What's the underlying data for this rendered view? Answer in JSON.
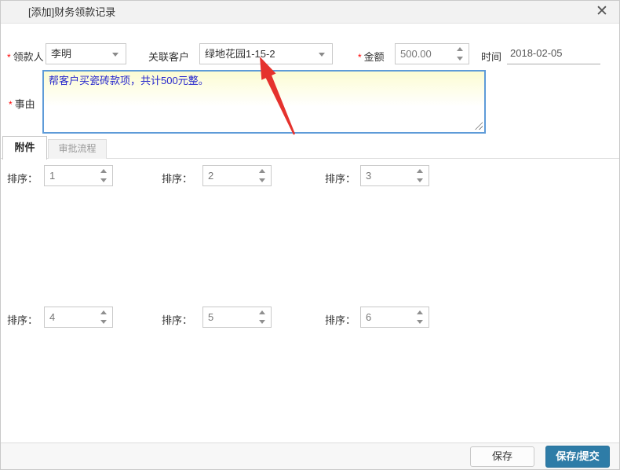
{
  "window": {
    "title": "[添加]财务领款记录",
    "close_icon": "✕"
  },
  "form": {
    "required_marker": "*",
    "payee": {
      "label": "领款人",
      "value": "李明",
      "required": true
    },
    "customer": {
      "label": "关联客户",
      "value": "绿地花园1-15-2",
      "required": false
    },
    "amount": {
      "label": "金额",
      "value": "500.00",
      "required": true
    },
    "date": {
      "label": "时间",
      "value": "2018-02-05",
      "required": false
    },
    "reason": {
      "label": "事由",
      "value": "帮客户买瓷砖款项，共计500元整。",
      "required": true
    }
  },
  "tabs": {
    "attachments": {
      "label": "附件",
      "active": true
    },
    "approval_flow": {
      "label": "审批流程",
      "active": false
    }
  },
  "attachments_panel": {
    "sort_label": "排序：",
    "items": [
      {
        "sort": "1"
      },
      {
        "sort": "2"
      },
      {
        "sort": "3"
      },
      {
        "sort": "4"
      },
      {
        "sort": "5"
      },
      {
        "sort": "6"
      }
    ]
  },
  "footer": {
    "save": "保存",
    "save_submit": "保存/提交"
  },
  "colors": {
    "primary_button": "#2e7ca7",
    "annotation_arrow": "#e5322d",
    "reason_text_blue": "#2525cd",
    "focused_border_blue": "#5e9bd8",
    "required_red": "#ff0000"
  }
}
